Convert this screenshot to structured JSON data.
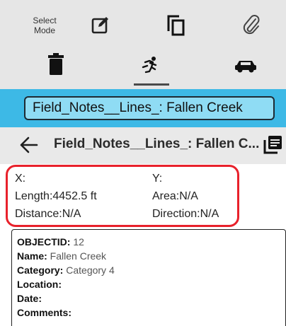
{
  "toolbar": {
    "select_mode_line1": "Select",
    "select_mode_line2": "Mode",
    "icons": [
      "edit-icon",
      "copy-icon",
      "attachment-icon",
      "delete-icon",
      "walking-mode-icon",
      "driving-mode-icon"
    ]
  },
  "title_bar": {
    "title": "Field_Notes__Lines_: Fallen Creek"
  },
  "nav_bar": {
    "title": "Field_Notes__Lines_: Fallen C..."
  },
  "measurements": {
    "x": "X:",
    "y": "Y:",
    "length": "Length:4452.5 ft",
    "area": "Area:N/A",
    "distance": "Distance:N/A",
    "direction": "Direction:N/A"
  },
  "attributes": [
    {
      "key": "OBJECTID:",
      "value": " 12"
    },
    {
      "key": "Name:",
      "value": " Fallen Creek"
    },
    {
      "key": "Category:",
      "value": " Category 4"
    },
    {
      "key": "Location:",
      "value": ""
    },
    {
      "key": "Date:",
      "value": ""
    },
    {
      "key": "Comments:",
      "value": ""
    }
  ],
  "colors": {
    "toolbar_bg": "#e6e6e6",
    "title_bar_bg": "#3db9e6",
    "title_box_bg": "#8fdcf4",
    "highlight_border": "#e8212b"
  }
}
